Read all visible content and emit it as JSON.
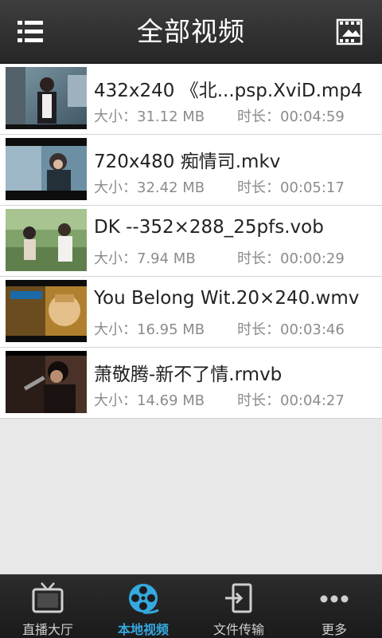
{
  "header": {
    "title": "全部视频",
    "menu_icon": "list-menu-icon",
    "media_icon": "media-library-icon"
  },
  "videos": [
    {
      "title": "432x240 《北...psp.XviD.mp4",
      "size": "大小：31.12 MB",
      "duration": "时长：00:04:59"
    },
    {
      "title": "720x480 痴情司.mkv",
      "size": "大小：32.42 MB",
      "duration": "时长：00:05:17"
    },
    {
      "title": "DK --352×288_25pfs.vob",
      "size": "大小：7.94 MB",
      "duration": "时长：00:00:29"
    },
    {
      "title": "You Belong Wit.20×240.wmv",
      "size": "大小：16.95 MB",
      "duration": "时长：00:03:46"
    },
    {
      "title": "萧敬腾-新不了情.rmvb",
      "size": "大小：14.69 MB",
      "duration": "时长：00:04:27"
    }
  ],
  "tabs": [
    {
      "label": "直播大厅",
      "icon": "tv-icon",
      "active": false
    },
    {
      "label": "本地视频",
      "icon": "film-reel-icon",
      "active": true
    },
    {
      "label": "文件传输",
      "icon": "file-transfer-icon",
      "active": false
    },
    {
      "label": "更多",
      "icon": "more-dots-icon",
      "active": false
    }
  ],
  "colors": {
    "accent": "#35a9e0",
    "header_bg": "#2e2e2e",
    "list_bg": "#ffffff",
    "page_bg": "#e8e8e8"
  }
}
